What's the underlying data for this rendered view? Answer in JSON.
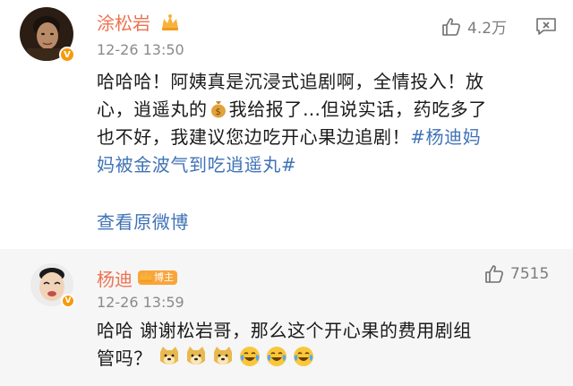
{
  "comment1": {
    "username": "涂松岩",
    "timestamp": "12-26 13:50",
    "likes": "4.2万",
    "text_lines": [
      "哈哈哈！阿姨真是沉浸式追剧啊，全情投入！放",
      "心，逍遥丸的",
      "我给报了…但说实话，药吃多了",
      "也不好，我建议您边吃开心果边追剧！",
      "#杨迪妈",
      "妈被金波气到吃逍遥丸#"
    ],
    "view_original": "查看原微博"
  },
  "comment2": {
    "username": "杨迪",
    "badge": "博主",
    "timestamp": "12-26 13:59",
    "likes": "7515",
    "text_lines": [
      "哈哈 谢谢松岩哥，那么这个开心果的费用剧组",
      "管吗？"
    ],
    "emojis": [
      "doge-emoji",
      "doge-emoji",
      "doge-emoji",
      "laugh-cry-emoji",
      "laugh-cry-emoji",
      "laugh-cry-emoji"
    ]
  },
  "colors": {
    "username": "#eb7350",
    "link": "#3f73b6",
    "meta": "#8a8a8a",
    "second_card_bg": "#f6f6f6",
    "verified": "#f59b0b"
  }
}
